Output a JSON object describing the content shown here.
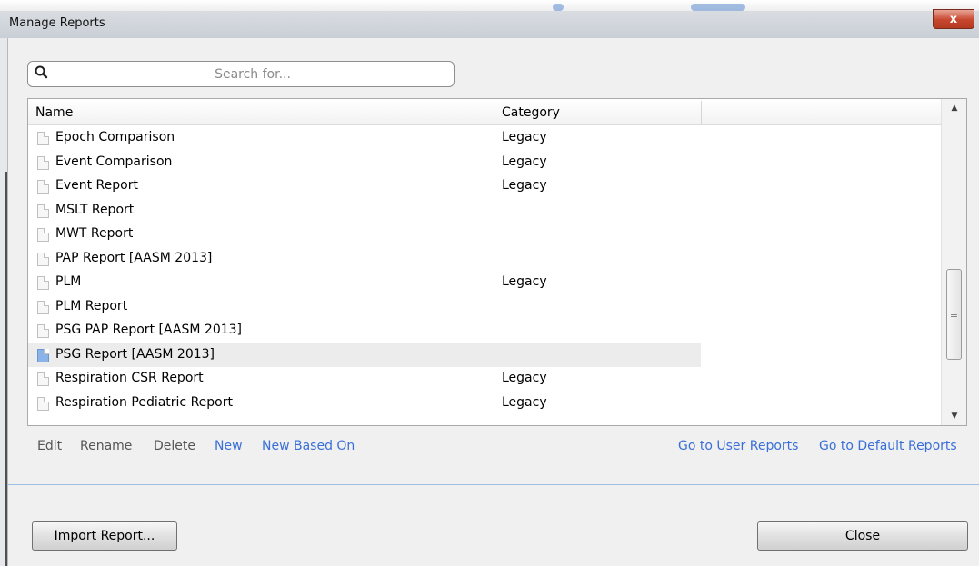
{
  "window": {
    "title": "Manage Reports",
    "close_glyph": "x"
  },
  "search": {
    "placeholder": "Search for...",
    "value": ""
  },
  "table": {
    "columns": [
      "Name",
      "Category"
    ],
    "rows": [
      {
        "name": "Epoch Comparison",
        "category": "Legacy",
        "icon": "report-icon"
      },
      {
        "name": "Event Comparison",
        "category": "Legacy",
        "icon": "report-icon"
      },
      {
        "name": "Event Report",
        "category": "Legacy",
        "icon": "report-icon"
      },
      {
        "name": "MSLT Report",
        "category": "",
        "icon": "report-icon"
      },
      {
        "name": "MWT Report",
        "category": "",
        "icon": "report-icon"
      },
      {
        "name": "PAP Report [AASM 2013]",
        "category": "",
        "icon": "report-icon"
      },
      {
        "name": "PLM",
        "category": "Legacy",
        "icon": "report-icon"
      },
      {
        "name": "PLM Report",
        "category": "",
        "icon": "report-icon"
      },
      {
        "name": "PSG PAP Report [AASM 2013]",
        "category": "",
        "icon": "report-icon"
      },
      {
        "name": "PSG Report [AASM 2013]",
        "category": "",
        "icon": "report-icon-selected",
        "selected": true
      },
      {
        "name": "Respiration CSR Report",
        "category": "Legacy",
        "icon": "report-icon"
      },
      {
        "name": "Respiration Pediatric Report",
        "category": "Legacy",
        "icon": "report-icon"
      }
    ]
  },
  "actions": {
    "edit": "Edit",
    "rename": "Rename",
    "delete": "Delete",
    "new": "New",
    "new_based_on": "New Based On",
    "go_user": "Go to User Reports",
    "go_default": "Go to Default Reports"
  },
  "buttons": {
    "import": "Import Report...",
    "close": "Close"
  },
  "colors": {
    "link": "#3a6fd8",
    "selected_row": "#ececec",
    "close_button": "#c7462e"
  }
}
